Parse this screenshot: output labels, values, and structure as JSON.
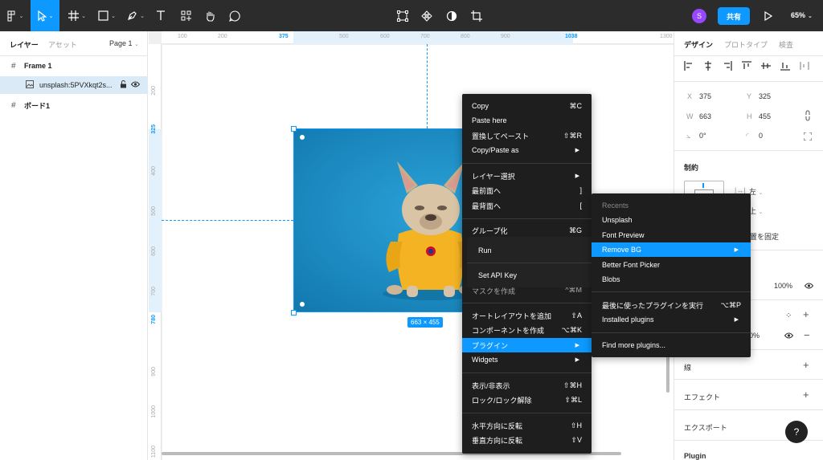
{
  "toolbar": {
    "tools": [
      {
        "name": "main-menu",
        "icon": "figma-logo-icon"
      },
      {
        "name": "move-tool",
        "icon": "cursor-arrow-icon",
        "active": true
      },
      {
        "name": "frame-tool",
        "icon": "hash-frame-icon"
      },
      {
        "name": "shape-tool",
        "icon": "rectangle-icon"
      },
      {
        "name": "pen-tool",
        "icon": "pen-icon"
      },
      {
        "name": "text-tool",
        "icon": "text-T-icon"
      },
      {
        "name": "resources-tool",
        "icon": "components-grid-icon"
      },
      {
        "name": "hand-tool",
        "icon": "hand-icon"
      },
      {
        "name": "comment-tool",
        "icon": "comment-bubble-icon"
      }
    ],
    "center_tools": [
      "mask-icon",
      "component-icon",
      "contrast-icon",
      "crop-icon"
    ],
    "avatar": "S",
    "share_label": "共有",
    "play_icon": "play-icon",
    "zoom": "65%",
    "accent": "#0d99ff"
  },
  "left_panel": {
    "tab_layers": "レイヤー",
    "tab_assets": "アセット",
    "page": "Page 1",
    "layers": [
      {
        "label": "Frame 1",
        "icon": "hash-frame-icon",
        "bold": true
      },
      {
        "label": "unsplash:5PVXkqt2s...",
        "icon": "image-icon",
        "selected": true
      },
      {
        "label": "ボード1",
        "icon": "hash-frame-icon",
        "bold": true
      }
    ]
  },
  "canvas": {
    "ruler_top": [
      "100",
      "200",
      "375",
      "500",
      "600",
      "700",
      "800",
      "900",
      "1038",
      "1300"
    ],
    "ruler_left": [
      "200",
      "325",
      "400",
      "500",
      "600",
      "700",
      "780",
      "900",
      "1000",
      "1100"
    ],
    "size_badge": "663 × 455"
  },
  "context_menu": {
    "items": [
      {
        "label": "Copy",
        "shortcut": "⌘C"
      },
      {
        "label": "Paste here",
        "shortcut": ""
      },
      {
        "label": "置換してペースト",
        "shortcut": "⇧⌘R"
      },
      {
        "label": "Copy/Paste as",
        "shortcut": "▶"
      },
      {
        "label": "レイヤー選択",
        "shortcut": "▶"
      },
      {
        "label": "最前面へ",
        "shortcut": "]"
      },
      {
        "label": "最背面へ",
        "shortcut": "["
      },
      {
        "label": "グループ化",
        "shortcut": "⌘G"
      },
      {
        "label": "マスクを作成",
        "shortcut": "^⌘M"
      },
      {
        "label": "オートレイアウトを追加",
        "shortcut": "⇧A"
      },
      {
        "label": "コンポーネントを作成",
        "shortcut": "⌥⌘K"
      },
      {
        "label": "プラグイン",
        "shortcut": "▶"
      },
      {
        "label": "Widgets",
        "shortcut": "▶"
      },
      {
        "label": "表示/非表示",
        "shortcut": "⇧⌘H"
      },
      {
        "label": "ロック/ロック解除",
        "shortcut": "⇧⌘L"
      },
      {
        "label": "水平方向に反転",
        "shortcut": "⇧H"
      },
      {
        "label": "垂直方向に反転",
        "shortcut": "⇧V"
      }
    ],
    "plugin_popup": [
      "Run",
      "Set API Key"
    ]
  },
  "submenu": {
    "items": [
      {
        "label": "Recents",
        "shortcut": ""
      },
      {
        "label": "Unsplash",
        "shortcut": ""
      },
      {
        "label": "Font Preview",
        "shortcut": ""
      },
      {
        "label": "Remove BG",
        "shortcut": "▶"
      },
      {
        "label": "Better Font Picker",
        "shortcut": ""
      },
      {
        "label": "Blobs",
        "shortcut": ""
      },
      {
        "label": "最後に使ったプラグインを実行",
        "shortcut": "⌥⌘P"
      },
      {
        "label": "Installed plugins",
        "shortcut": "▶"
      },
      {
        "label": "Find more plugins...",
        "shortcut": ""
      }
    ]
  },
  "right_panel": {
    "tabs": [
      "デザイン",
      "プロトタイプ",
      "検査"
    ],
    "x_label": "X",
    "x_value": "375",
    "y_label": "Y",
    "y_value": "325",
    "w_label": "W",
    "w_value": "663",
    "h_label": "H",
    "h_value": "455",
    "rotation": "0°",
    "radius": "0",
    "constraints_title": "制約",
    "constraint_h": "左",
    "constraint_v": "上",
    "fix_position": "位置を固定",
    "layer_opacity": "100%",
    "fill_opacity": "0%",
    "stroke_title": "線",
    "effects_title": "エフェクト",
    "export_title": "エクスポート",
    "plugin_title": "Plugin",
    "help": "?"
  }
}
